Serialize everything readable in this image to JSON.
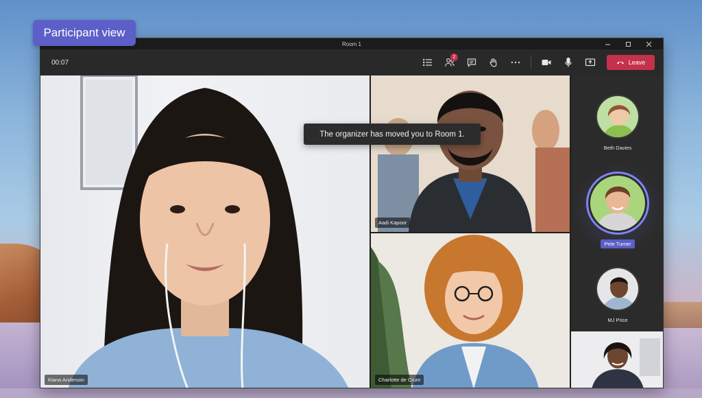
{
  "label_pill": "Participant view",
  "window": {
    "title": "Room 1",
    "controls": {
      "minimize_icon": "minimize-icon",
      "maximize_icon": "maximize-icon",
      "close_icon": "close-icon"
    }
  },
  "toolbar": {
    "timer": "00:07",
    "notification_count": "2",
    "leave_label": "Leave",
    "tools": [
      "participants-list-icon",
      "people-icon",
      "chat-icon",
      "raise-hand-icon",
      "more-icon",
      "camera-icon",
      "microphone-icon",
      "share-screen-icon"
    ]
  },
  "toast": {
    "message": "The organizer has moved you to Room 1."
  },
  "participants": {
    "main": "Kiana Anderson",
    "top_right": "Aadi Kapoor",
    "bottom_right": "Charlotte de Crum"
  },
  "rail": [
    {
      "name": "Beth Davies",
      "active": false
    },
    {
      "name": "Pete Turner",
      "active": true
    },
    {
      "name": "MJ Price",
      "active": false
    }
  ],
  "colors": {
    "accent": "#5b5fc7",
    "leave": "#c4314b",
    "window_bg": "#1f1f1f",
    "toolbar_bg": "#292929"
  }
}
